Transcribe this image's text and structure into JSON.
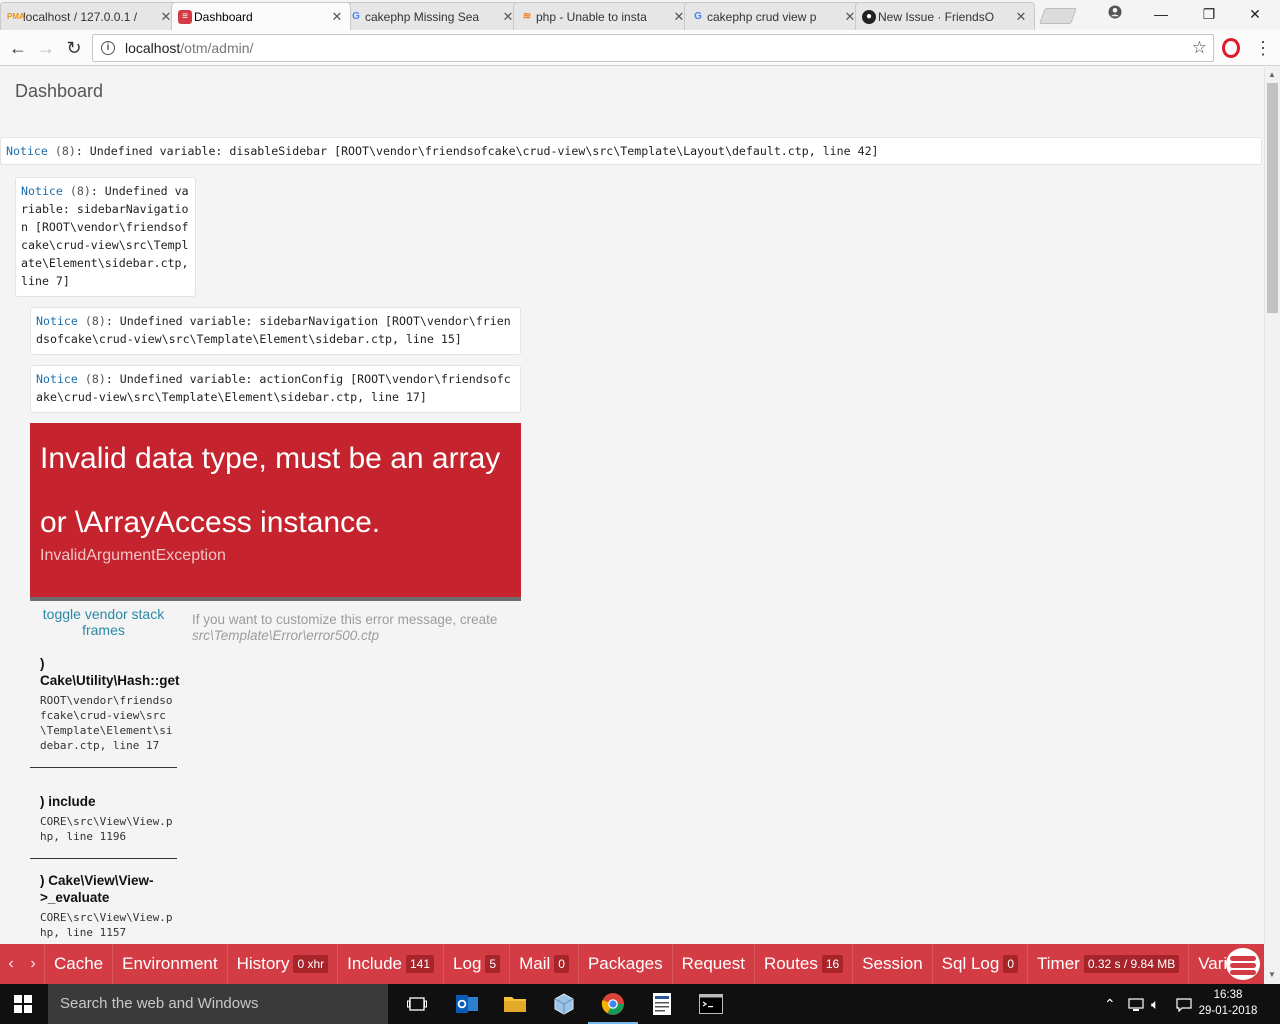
{
  "browser": {
    "tabs": [
      {
        "title": "localhost / 127.0.0.1 / ",
        "favicon": "phpmyadmin-icon",
        "active": false
      },
      {
        "title": "Dashboard",
        "favicon": "cakephp-icon",
        "active": true
      },
      {
        "title": "cakephp Missing Sea",
        "favicon": "google-icon",
        "active": false
      },
      {
        "title": "php - Unable to insta",
        "favicon": "stackoverflow-icon",
        "active": false
      },
      {
        "title": "cakephp crud view p",
        "favicon": "google-icon",
        "active": false
      },
      {
        "title": "New Issue · FriendsO",
        "favicon": "github-icon",
        "active": false
      }
    ],
    "address": {
      "host": "localhost",
      "path": "/otm/admin/"
    }
  },
  "page": {
    "title": "Dashboard",
    "notices": [
      {
        "label": "Notice",
        "code": "(8)",
        "text": ": Undefined variable: disableSidebar [ROOT\\vendor\\friendsofcake\\crud-view\\src\\Template\\Layout\\default.ctp, line 42]"
      },
      {
        "label": "Notice",
        "code": "(8)",
        "text": ": Undefined variable: sidebarNavigation [ROOT\\vendor\\friendsofcake\\crud-view\\src\\Template\\Element\\sidebar.ctp, line 7]"
      },
      {
        "label": "Notice",
        "code": "(8)",
        "text": ": Undefined variable: sidebarNavigation [ROOT\\vendor\\friendsofcake\\crud-view\\src\\Template\\Element\\sidebar.ctp, line 15]"
      },
      {
        "label": "Notice",
        "code": "(8)",
        "text": ": Undefined variable: actionConfig [ROOT\\vendor\\friendsofcake\\crud-view\\src\\Template\\Element\\sidebar.ctp, line 17]"
      }
    ],
    "error": {
      "message": "Invalid data type, must be an array or \\ArrayAccess instance.",
      "type": "InvalidArgumentException"
    },
    "toggle_link": "toggle vendor stack frames",
    "hint": {
      "text": "If you want to customize this error message, create",
      "path": "src\\Template\\Error\\error500.ctp"
    },
    "stack_frames": [
      {
        "name": ") Cake\\Utility\\Hash::get",
        "location": "ROOT\\vendor\\friendsofcake\\crud-view\\src\\Template\\Element\\sidebar.ctp, line 17"
      },
      {
        "name": ") include",
        "location": "CORE\\src\\View\\View.php, line 1196"
      },
      {
        "name": ") Cake\\View\\View->_evaluate",
        "location": "CORE\\src\\View\\View.php, line 1157"
      }
    ]
  },
  "debugkit": {
    "panels": [
      {
        "label": "Cache",
        "badge": ""
      },
      {
        "label": "Environment",
        "badge": ""
      },
      {
        "label": "History",
        "badge": "0 xhr"
      },
      {
        "label": "Include",
        "badge": "141"
      },
      {
        "label": "Log",
        "badge": "5"
      },
      {
        "label": "Mail",
        "badge": "0"
      },
      {
        "label": "Packages",
        "badge": ""
      },
      {
        "label": "Request",
        "badge": ""
      },
      {
        "label": "Routes",
        "badge": "16"
      },
      {
        "label": "Session",
        "badge": ""
      },
      {
        "label": "Sql Log",
        "badge": "0"
      },
      {
        "label": "Timer",
        "badge": "0.32 s / 9.84 MB"
      },
      {
        "label": "Varia",
        "badge": ""
      }
    ],
    "accent": "#d33c44"
  },
  "taskbar": {
    "search_placeholder": "Search the web and Windows",
    "time": "16:38",
    "date": "29-01-2018"
  }
}
